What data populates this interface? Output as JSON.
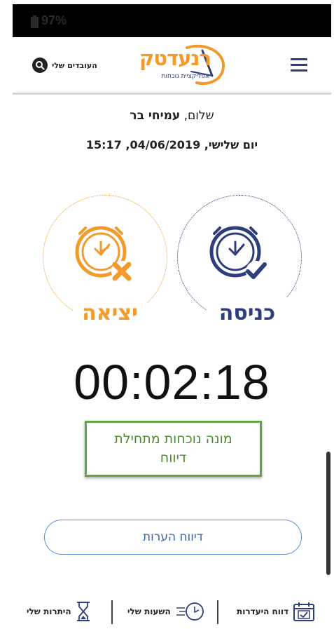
{
  "status_bar": {
    "battery": "97%"
  },
  "header": {
    "logo_text": "רנעדטק",
    "logo_subtitle": "אפליקציית נוכחות",
    "my_employees": "העובדים שלי"
  },
  "greeting": {
    "prefix": "שלום,",
    "name": "עמיחי בר"
  },
  "datetime": "יום שלישי, 04/06/2019, 15:17",
  "buttons": {
    "entry": "כניסה",
    "exit": "יציאה"
  },
  "timer": "00:02:18",
  "toast": {
    "line1": "מונה נוכחות מתחילת",
    "line2": "דיווח"
  },
  "notes_button": "דיווח הערות",
  "bottom_nav": {
    "absence_report": "דווח היעדרות",
    "my_hours": "השעות שלי",
    "my_balances": "היתרות שלי"
  },
  "colors": {
    "orange": "#f39a2c",
    "navy": "#2f3e7a",
    "green": "#62a545",
    "blue": "#3c66b0"
  }
}
